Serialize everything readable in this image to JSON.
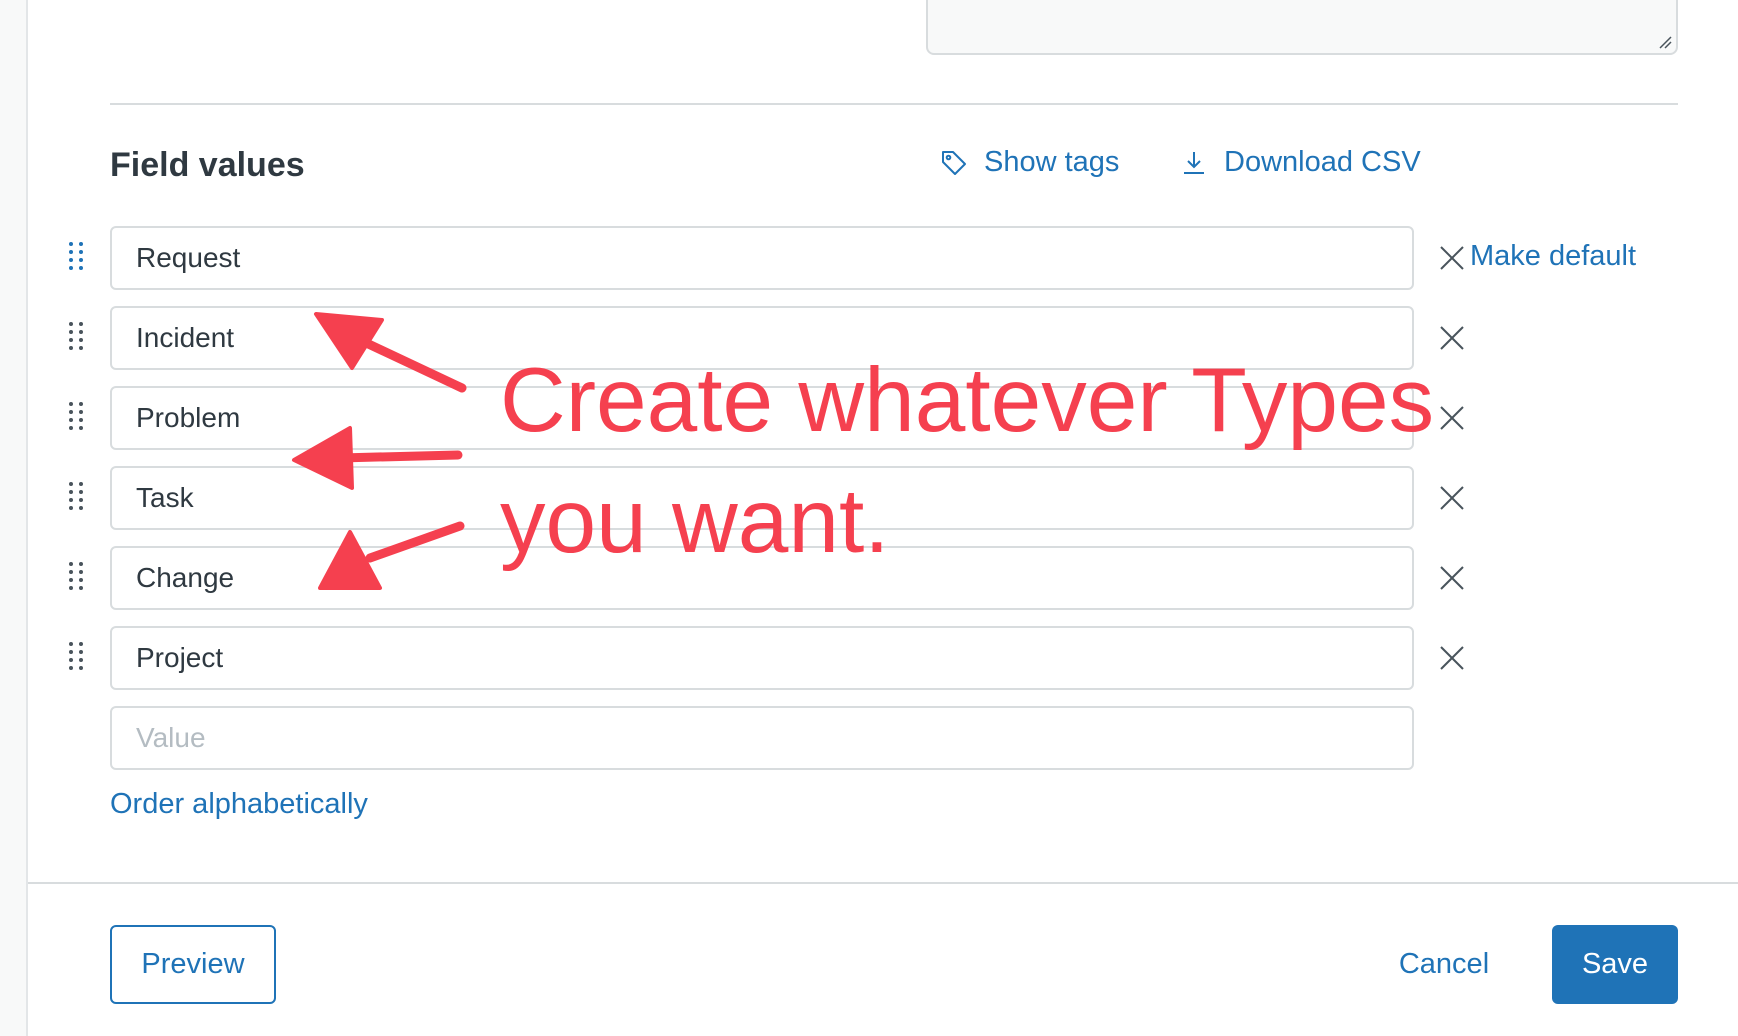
{
  "section": {
    "title": "Field values",
    "show_tags_label": "Show tags",
    "download_csv_label": "Download CSV"
  },
  "field_values": [
    {
      "value": "Request",
      "make_default_label": "Make default"
    },
    {
      "value": "Incident"
    },
    {
      "value": "Problem"
    },
    {
      "value": "Task"
    },
    {
      "value": "Change"
    },
    {
      "value": "Project"
    }
  ],
  "new_value": {
    "placeholder": "Value",
    "value": ""
  },
  "order_alphabetically_label": "Order alphabetically",
  "footer": {
    "preview_label": "Preview",
    "cancel_label": "Cancel",
    "save_label": "Save"
  },
  "annotation": {
    "line1": "Create whatever Types",
    "line2": "you want.",
    "color": "#f5404f"
  },
  "colors": {
    "link": "#1f73b7",
    "primary_button": "#1f73b7",
    "text": "#2f3941",
    "border": "#d8dcde"
  },
  "icons": {
    "tag": "tag-icon",
    "download": "download-icon",
    "drag": "drag-handle-icon",
    "remove": "close-icon",
    "resize": "resize-grip-icon"
  }
}
